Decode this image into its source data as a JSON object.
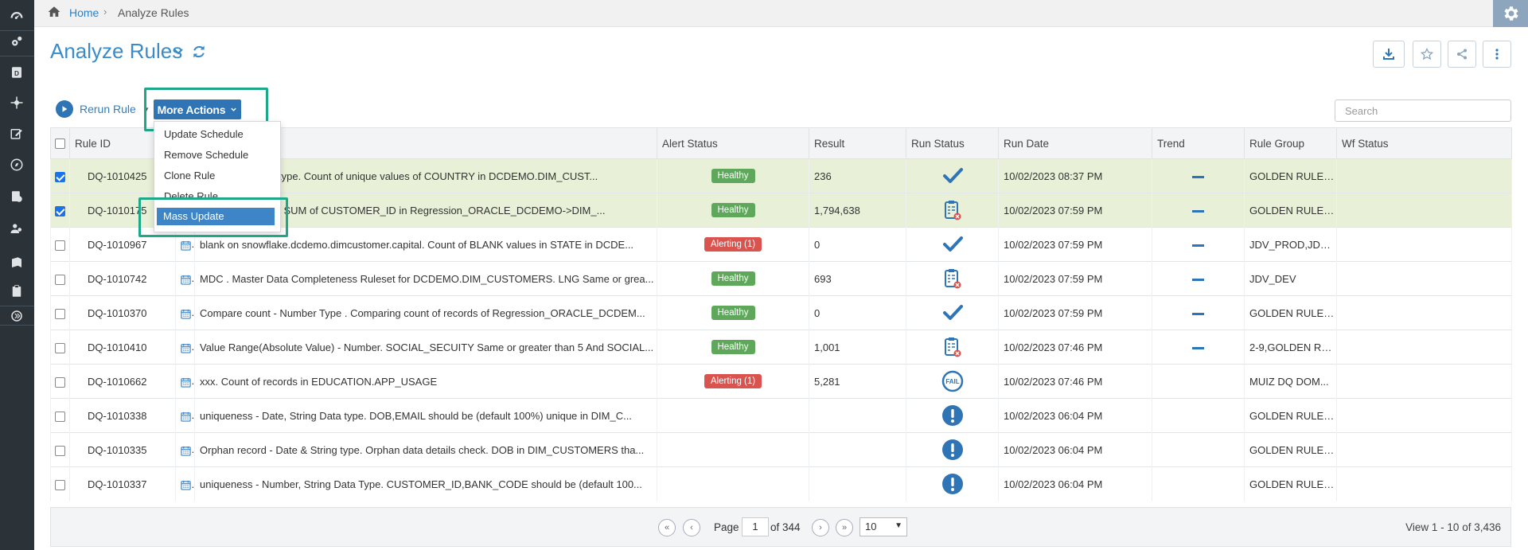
{
  "breadcrumb": {
    "home": "Home",
    "current": "Analyze Rules"
  },
  "page": {
    "title": "Analyze Rules"
  },
  "toolbar": {
    "rerun_label": "Rerun Rule",
    "more_actions_label": "More Actions",
    "search_placeholder": "Search"
  },
  "menu": {
    "items": [
      "Update Schedule",
      "Remove Schedule",
      "Clone Rule",
      "Delete Rule",
      "Mass Update"
    ],
    "highlighted": "Mass Update"
  },
  "table": {
    "columns": [
      "Rule ID",
      "Alert Status",
      "Result",
      "Run Status",
      "Run Date",
      "Trend",
      "Rule Group",
      "Wf Status"
    ],
    "rows": [
      {
        "checked": true,
        "id": "DQ-1010425",
        "desc": "ues - String data type. Count of unique values of COUNTRY in DCDEMO.DIM_CUST...",
        "alert": "Healthy",
        "result": "236",
        "run_status": "check",
        "run_date": "10/02/2023 08:37 PM",
        "trend": true,
        "group": "GOLDEN RULES..."
      },
      {
        "checked": true,
        "id": "DQ-1010175",
        "desc": "etrics. Comparing SUM of CUSTOMER_ID in Regression_ORACLE_DCDEMO->DIM_...",
        "alert": "Healthy",
        "result": "1,794,638",
        "run_status": "clipboard",
        "run_date": "10/02/2023 07:59 PM",
        "trend": true,
        "group": "GOLDEN RULES..."
      },
      {
        "checked": false,
        "id": "DQ-1010967",
        "desc": "blank on snowflake.dcdemo.dimcustomer.capital. Count of BLANK values in STATE in DCDE...",
        "alert": "Alerting (1)",
        "result": "0",
        "run_status": "check",
        "run_date": "10/02/2023 07:59 PM",
        "trend": true,
        "group": "JDV_PROD,JDV_..."
      },
      {
        "checked": false,
        "id": "DQ-1010742",
        "desc": "MDC . Master Data Completeness Ruleset for DCDEMO.DIM_CUSTOMERS. LNG Same or grea...",
        "alert": "Healthy",
        "result": "693",
        "run_status": "clipboard",
        "run_date": "10/02/2023 07:59 PM",
        "trend": true,
        "group": "JDV_DEV"
      },
      {
        "checked": false,
        "id": "DQ-1010370",
        "desc": "Compare count - Number Type . Comparing count of records of Regression_ORACLE_DCDEM...",
        "alert": "Healthy",
        "result": "0",
        "run_status": "check",
        "run_date": "10/02/2023 07:59 PM",
        "trend": true,
        "group": "GOLDEN RULES..."
      },
      {
        "checked": false,
        "id": "DQ-1010410",
        "desc": "Value Range(Absolute Value) - Number. SOCIAL_SECUITY Same or greater than 5 And SOCIAL...",
        "alert": "Healthy",
        "result": "1,001",
        "run_status": "clipboard",
        "run_date": "10/02/2023 07:46 PM",
        "trend": true,
        "group": "2-9,GOLDEN RU..."
      },
      {
        "checked": false,
        "id": "DQ-1010662",
        "desc": "xxx. Count of records in EDUCATION.APP_USAGE",
        "alert": "Alerting (1)",
        "result": "5,281",
        "run_status": "failed",
        "run_date": "10/02/2023 07:46 PM",
        "trend": false,
        "group": "MUIZ DQ DOM..."
      },
      {
        "checked": false,
        "id": "DQ-1010338",
        "desc": "uniqueness -  Date, String Data type. DOB,EMAIL should be  (default 100%) unique  in DIM_C...",
        "alert": "",
        "result": "",
        "run_status": "info",
        "run_date": "10/02/2023 06:04 PM",
        "trend": false,
        "group": "GOLDEN RULES..."
      },
      {
        "checked": false,
        "id": "DQ-1010335",
        "desc": "Orphan record - Date & String type. Orphan data details check. DOB in DIM_CUSTOMERS tha...",
        "alert": "",
        "result": "",
        "run_status": "info",
        "run_date": "10/02/2023 06:04 PM",
        "trend": false,
        "group": "GOLDEN RULES..."
      },
      {
        "checked": false,
        "id": "DQ-1010337",
        "desc": "uniqueness - Number, String Data Type. CUSTOMER_ID,BANK_CODE should be  (default 100...",
        "alert": "",
        "result": "",
        "run_status": "info",
        "run_date": "10/02/2023 06:04 PM",
        "trend": false,
        "group": "GOLDEN RULES..."
      }
    ]
  },
  "pager": {
    "page_label": "Page",
    "current_page": "1",
    "of_label": "of 344",
    "page_size": "10",
    "view_text": "View 1 - 10 of 3,436"
  },
  "colors": {
    "accent": "#2f75b5",
    "highlight": "#1da88a",
    "healthy": "#5fa85b",
    "alerting": "#d9534f",
    "selected_row": "#e8f0d8",
    "sidebar": "#2b3238"
  }
}
